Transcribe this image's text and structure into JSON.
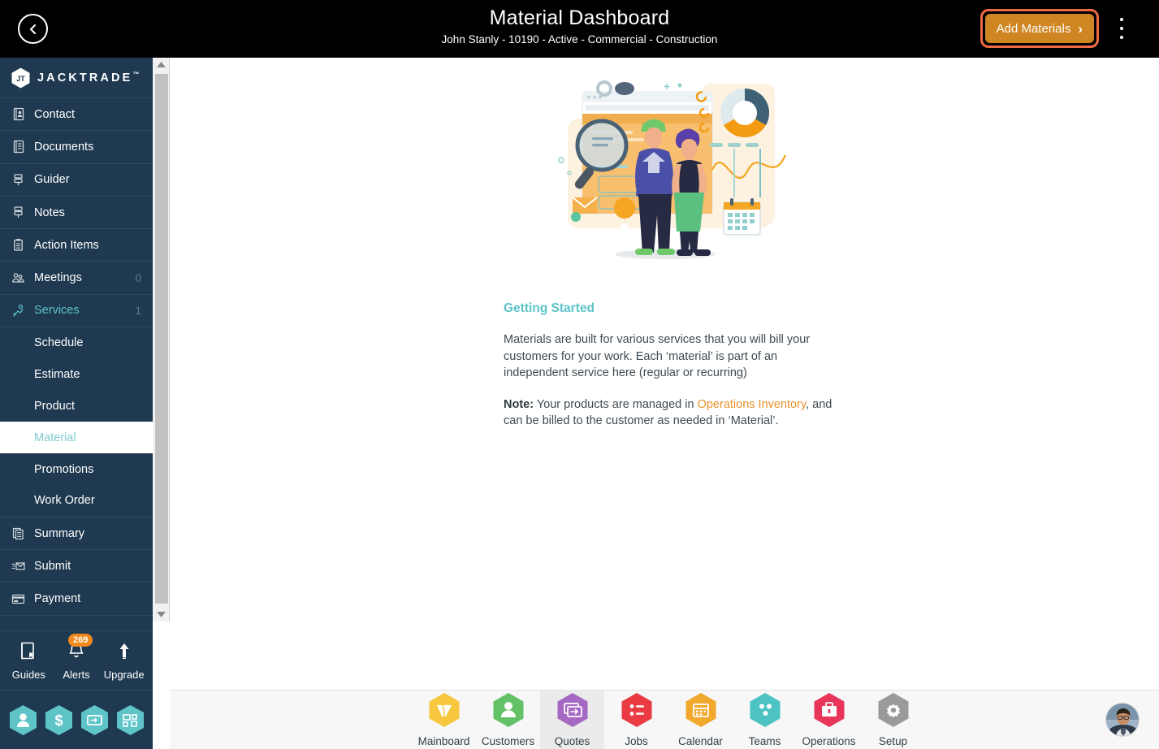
{
  "topbar": {
    "back_icon": "chevron-left-circle-icon",
    "title": "Material Dashboard",
    "subtitle": "John Stanly - 10190 - Active - Commercial - Construction",
    "add_button_label": "Add Materials",
    "add_button_chevron": "›",
    "add_button_color": "#cf8522",
    "add_button_ring_color": "#ef6b45",
    "menu_icon": "kebab-menu-icon"
  },
  "sidebar": {
    "logo_text": "JACKTRADE",
    "logo_tm": "™",
    "background": "#1e3950",
    "accent": "#5fc4c9",
    "items": [
      {
        "label": "Contact",
        "icon": "contact-book-icon",
        "count": ""
      },
      {
        "label": "Documents",
        "icon": "documents-icon",
        "count": ""
      },
      {
        "label": "Guider",
        "icon": "guider-icon",
        "count": ""
      },
      {
        "label": "Notes",
        "icon": "notes-icon",
        "count": ""
      },
      {
        "label": "Action Items",
        "icon": "clipboard-icon",
        "count": ""
      },
      {
        "label": "Meetings",
        "icon": "meetings-icon",
        "count": "0"
      },
      {
        "label": "Services",
        "icon": "services-icon",
        "count": "1",
        "active": true
      }
    ],
    "subitems": [
      {
        "label": "Schedule"
      },
      {
        "label": "Estimate"
      },
      {
        "label": "Product"
      },
      {
        "label": "Material",
        "selected": true
      },
      {
        "label": "Promotions"
      },
      {
        "label": "Work Order"
      }
    ],
    "items_after": [
      {
        "label": "Summary",
        "icon": "summary-pages-icon",
        "count": ""
      },
      {
        "label": "Submit",
        "icon": "submit-envelope-icon",
        "count": ""
      },
      {
        "label": "Payment",
        "icon": "payment-card-icon",
        "count": ""
      }
    ],
    "tools": [
      {
        "label": "Guides",
        "icon": "book-icon",
        "badge": ""
      },
      {
        "label": "Alerts",
        "icon": "bell-icon",
        "badge": "269"
      },
      {
        "label": "Upgrade",
        "icon": "upload-arrow-icon",
        "badge": ""
      }
    ],
    "hex_buttons": [
      {
        "icon": "user-hex-icon",
        "color": "#5ec4c8"
      },
      {
        "icon": "dollar-hex-icon",
        "color": "#5ec4c8"
      },
      {
        "icon": "payment-hex-icon",
        "color": "#5ec4c8"
      },
      {
        "icon": "workflow-hex-icon",
        "color": "#5ec4c8"
      }
    ]
  },
  "scrollbar": {
    "up_icon": "scroll-up-arrow-icon",
    "down_icon": "scroll-down-arrow-icon"
  },
  "main": {
    "illustration": "analytics-team-illustration",
    "getting_started_title": "Getting Started",
    "paragraph_1": "Materials are built for various services that you will bill your customers for your work. Each ‘material’ is part of an independent service here (regular or recurring)",
    "note_label": "Note:",
    "note_text_1": " Your products are managed in ",
    "note_link": "Operations Inventory",
    "note_text_2": ", and can be billed to the customer as needed in ‘Material’.",
    "title_color": "#5bc4c8",
    "link_color": "#e8922c"
  },
  "bottomnav": {
    "items": [
      {
        "label": "Mainboard",
        "icon": "mainboard-hex-icon",
        "color": "#f7c73f"
      },
      {
        "label": "Customers",
        "icon": "customers-hex-icon",
        "color": "#63c167"
      },
      {
        "label": "Quotes",
        "icon": "quotes-hex-icon",
        "color": "#a濃",
        "active": true
      },
      {
        "label": "Jobs",
        "icon": "jobs-hex-icon",
        "color": "#ea3b42"
      },
      {
        "label": "Calendar",
        "icon": "calendar-hex-icon",
        "color": "#f0a92c"
      },
      {
        "label": "Teams",
        "icon": "teams-hex-icon",
        "color": "#4cc2c2"
      },
      {
        "label": "Operations",
        "icon": "operations-hex-icon",
        "color": "#e8365b"
      },
      {
        "label": "Setup",
        "icon": "setup-hex-icon",
        "color": "#9a9a9a"
      }
    ],
    "avatar": "user-avatar"
  }
}
